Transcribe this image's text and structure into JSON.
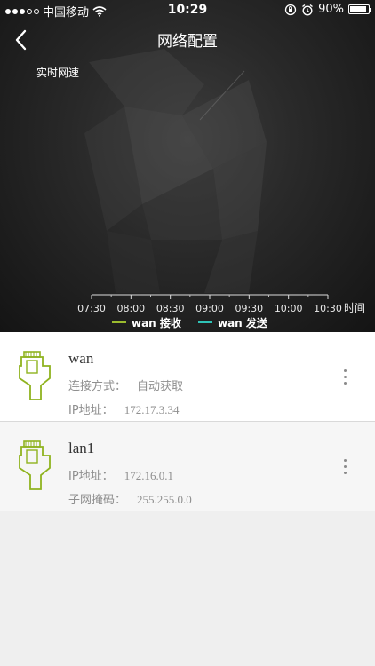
{
  "status_bar": {
    "carrier": "中国移动",
    "time": "10:29",
    "battery": "90%",
    "battery_level": 0.9,
    "icons": [
      "signal-dots-icon",
      "wifi-icon",
      "rotation-lock-icon",
      "alarm-icon",
      "battery-icon"
    ]
  },
  "nav": {
    "title": "网络配置",
    "back_icon": "chevron-left-icon"
  },
  "chart_data": {
    "type": "line",
    "title": "实时网速",
    "xlabel": "时间",
    "categories": [
      "07:30",
      "08:00",
      "08:30",
      "09:00",
      "09:30",
      "10:00",
      "10:30"
    ],
    "series": [
      {
        "name": "wan  接收",
        "color": "#9bbb2e",
        "values": []
      },
      {
        "name": "wan  发送",
        "color": "#2fc3b7",
        "values": []
      }
    ],
    "grid": false,
    "legend": "bottom"
  },
  "interfaces": [
    {
      "name": "wan",
      "rows": [
        {
          "label": "连接方式：",
          "value": "自动获取"
        },
        {
          "label": "IP地址：",
          "value": "172.17.3.34"
        }
      ],
      "icon": "ethernet-port-icon",
      "more_icon": "more-vertical-icon"
    },
    {
      "name": "lan1",
      "rows": [
        {
          "label": "IP地址：",
          "value": "172.16.0.1"
        },
        {
          "label": "子网掩码：",
          "value": "255.255.0.0"
        }
      ],
      "icon": "ethernet-port-icon",
      "more_icon": "more-vertical-icon"
    }
  ],
  "colors": {
    "accent_green": "#9bbb2e",
    "accent_teal": "#2fc3b7",
    "header_bg": "#2a2a2a",
    "page_bg": "#efefef"
  }
}
